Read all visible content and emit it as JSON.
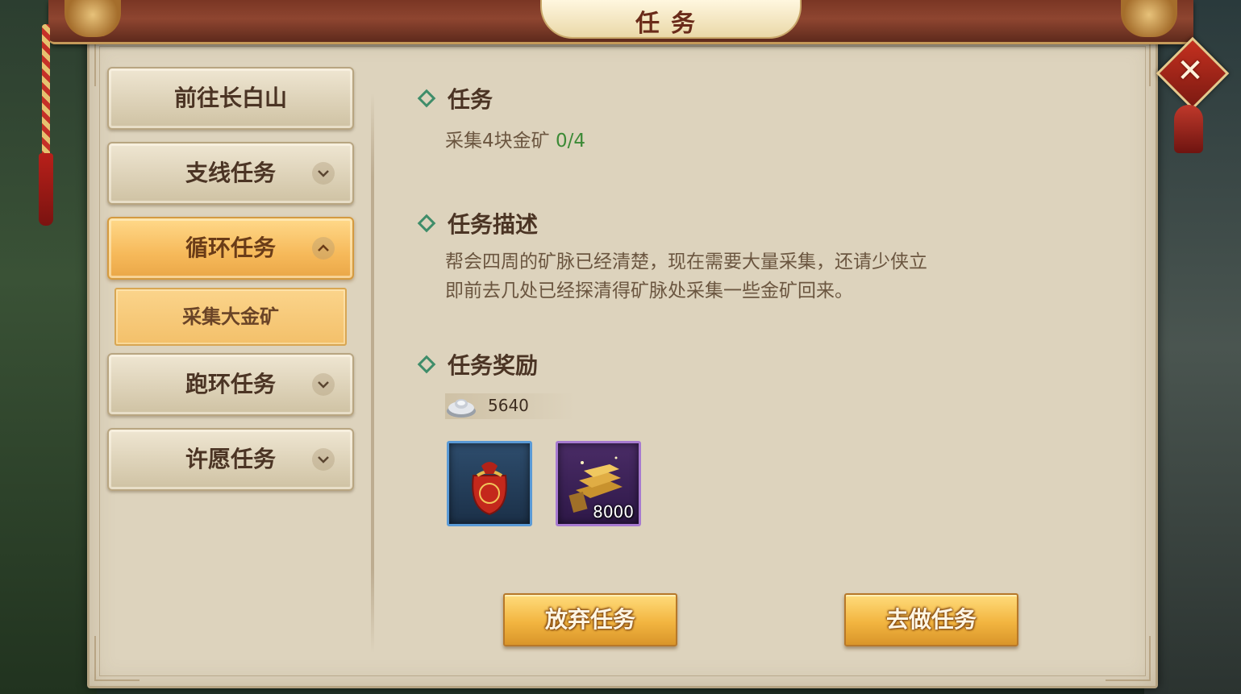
{
  "window": {
    "title": "任务"
  },
  "nav": {
    "items": [
      {
        "label": "前往长白山",
        "expandable": false,
        "active": false
      },
      {
        "label": "支线任务",
        "expandable": true,
        "expanded": false,
        "active": false
      },
      {
        "label": "循环任务",
        "expandable": true,
        "expanded": true,
        "active": true
      },
      {
        "label": "跑环任务",
        "expandable": true,
        "expanded": false,
        "active": false
      },
      {
        "label": "许愿任务",
        "expandable": true,
        "expanded": false,
        "active": false
      }
    ],
    "sub_item": {
      "label": "采集大金矿",
      "selected": true
    }
  },
  "task": {
    "section_title": "任务",
    "objective_text": "采集4块金矿",
    "objective_progress": "0/4"
  },
  "description": {
    "section_title": "任务描述",
    "line1": "帮会四周的矿脉已经清楚，现在需要大量采集，还请少侠立",
    "line2": "即前去几处已经探清得矿脉处采集一些金矿回来。"
  },
  "reward": {
    "section_title": "任务奖励",
    "silver_icon": "silver-ingot-icon",
    "silver_amount": "5640",
    "items": [
      {
        "icon": "lucky-bag-icon",
        "quality_color": "#5a9ad6",
        "quantity": ""
      },
      {
        "icon": "gold-bars-icon",
        "quality_color": "#a77ad0",
        "quantity": "8000"
      }
    ]
  },
  "buttons": {
    "abandon": "放弃任务",
    "go": "去做任务"
  },
  "colors": {
    "panel_bg": "#ddd3bd",
    "accent_gold": "#f2b540",
    "progress_green": "#3c8a36",
    "bullet_green": "#3f8d6a"
  }
}
